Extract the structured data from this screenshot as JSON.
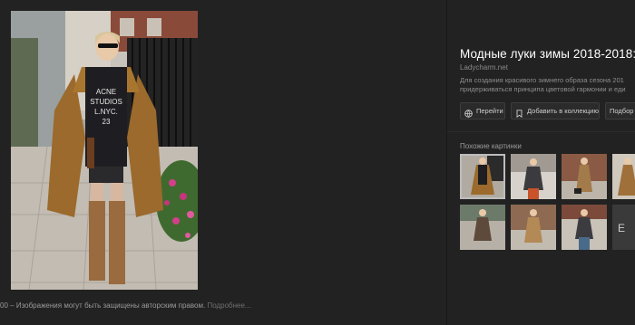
{
  "footer": {
    "prefix": "00",
    "copyright_text": "– Изображения могут быть защищены авторским правом.",
    "more_link": "Подробнее..."
  },
  "details": {
    "title": "Модные луки зимы 2018-2018:",
    "source": "Ladycharm.net",
    "description_line1": "Для создания красивого зимнего образа сезона 201",
    "description_line2": "придерживаться принципа цветовой гармонии и еди"
  },
  "actions": {
    "go_label": "Перейти",
    "add_label": "Добавить в коллекцию",
    "more_label": "Подбор"
  },
  "similar": {
    "title": "Похожие картинки",
    "thumb_last_text": "E"
  },
  "main_photo": {
    "sweater_text": [
      "ACNE",
      "STUDIOS",
      "L.NYC.",
      "23"
    ]
  },
  "colors": {
    "background": "#222222",
    "button_bg": "#2b2b2b",
    "title": "#ffffff"
  }
}
